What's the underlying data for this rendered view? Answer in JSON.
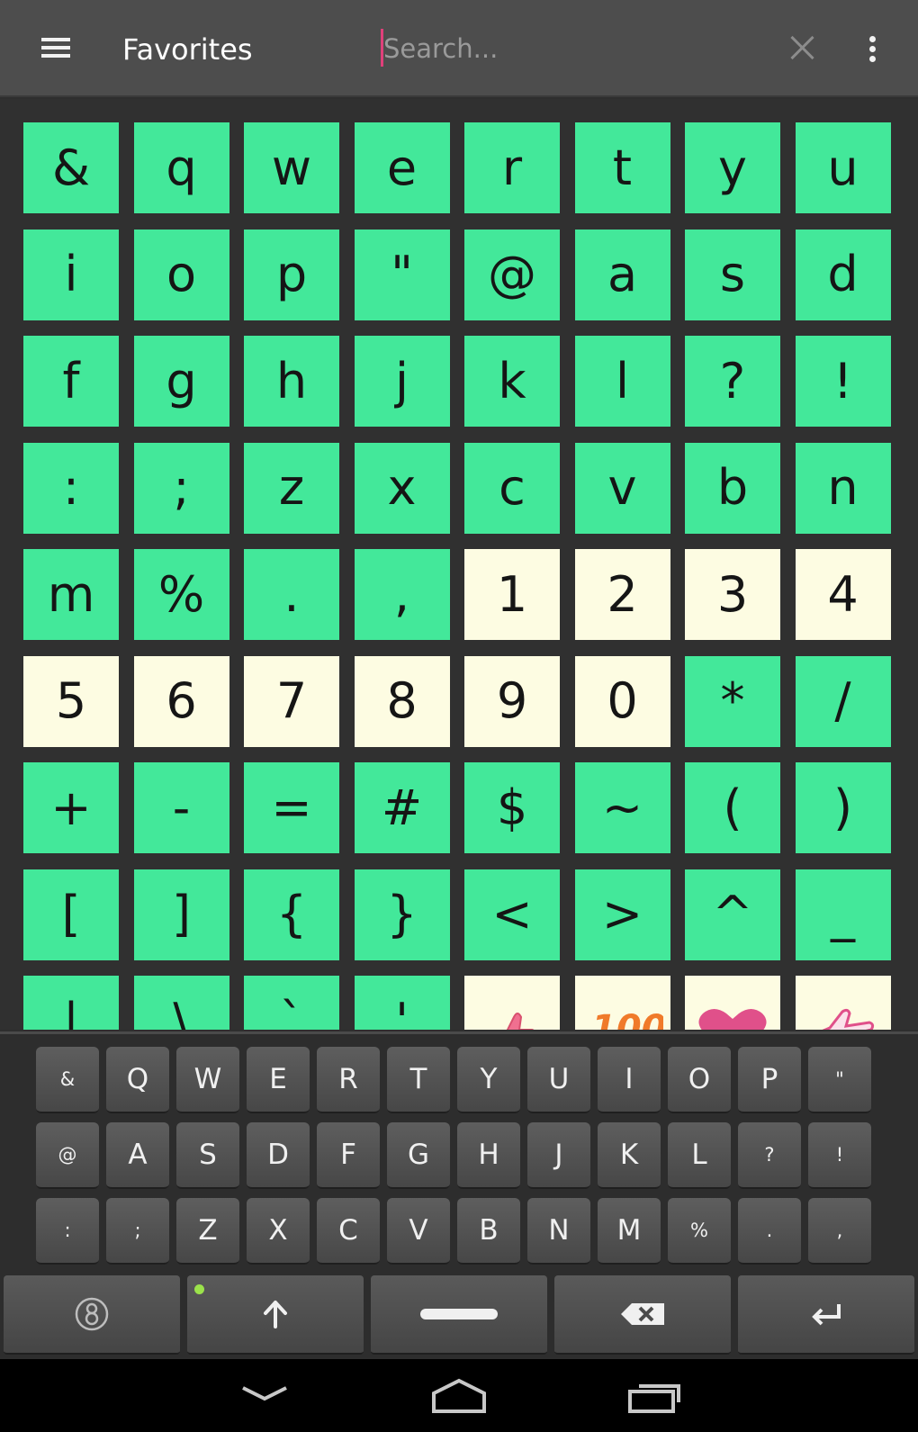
{
  "appbar": {
    "title": "Favorites",
    "search_placeholder": "Search...",
    "menu_icon": "hamburger-menu-icon",
    "clear_icon": "close-icon",
    "overflow_icon": "overflow-menu-icon"
  },
  "colors": {
    "appbar_bg": "#4d4d4d",
    "grid_bg": "#303030",
    "cell_symbol": "#43e89a",
    "cell_digit": "#fdfce2",
    "search_cursor": "#e0407a",
    "shift_indicator": "#9be24b"
  },
  "grid": {
    "rows": [
      [
        {
          "c": "&",
          "t": "green"
        },
        {
          "c": "q",
          "t": "green"
        },
        {
          "c": "w",
          "t": "green"
        },
        {
          "c": "e",
          "t": "green"
        },
        {
          "c": "r",
          "t": "green"
        },
        {
          "c": "t",
          "t": "green"
        },
        {
          "c": "y",
          "t": "green"
        },
        {
          "c": "u",
          "t": "green"
        }
      ],
      [
        {
          "c": "i",
          "t": "green"
        },
        {
          "c": "o",
          "t": "green"
        },
        {
          "c": "p",
          "t": "green"
        },
        {
          "c": "\"",
          "t": "green"
        },
        {
          "c": "@",
          "t": "green"
        },
        {
          "c": "a",
          "t": "green"
        },
        {
          "c": "s",
          "t": "green"
        },
        {
          "c": "d",
          "t": "green"
        }
      ],
      [
        {
          "c": "f",
          "t": "green"
        },
        {
          "c": "g",
          "t": "green"
        },
        {
          "c": "h",
          "t": "green"
        },
        {
          "c": "j",
          "t": "green"
        },
        {
          "c": "k",
          "t": "green"
        },
        {
          "c": "l",
          "t": "green"
        },
        {
          "c": "?",
          "t": "green"
        },
        {
          "c": "!",
          "t": "green"
        }
      ],
      [
        {
          "c": ":",
          "t": "green"
        },
        {
          "c": ";",
          "t": "green"
        },
        {
          "c": "z",
          "t": "green"
        },
        {
          "c": "x",
          "t": "green"
        },
        {
          "c": "c",
          "t": "green"
        },
        {
          "c": "v",
          "t": "green"
        },
        {
          "c": "b",
          "t": "green"
        },
        {
          "c": "n",
          "t": "green"
        }
      ],
      [
        {
          "c": "m",
          "t": "green"
        },
        {
          "c": "%",
          "t": "green"
        },
        {
          "c": ".",
          "t": "green"
        },
        {
          "c": ",",
          "t": "green"
        },
        {
          "c": "1",
          "t": "cream"
        },
        {
          "c": "2",
          "t": "cream"
        },
        {
          "c": "3",
          "t": "cream"
        },
        {
          "c": "4",
          "t": "cream"
        }
      ],
      [
        {
          "c": "5",
          "t": "cream"
        },
        {
          "c": "6",
          "t": "cream"
        },
        {
          "c": "7",
          "t": "cream"
        },
        {
          "c": "8",
          "t": "cream"
        },
        {
          "c": "9",
          "t": "cream"
        },
        {
          "c": "0",
          "t": "cream"
        },
        {
          "c": "*",
          "t": "green"
        },
        {
          "c": "/",
          "t": "green"
        }
      ],
      [
        {
          "c": "+",
          "t": "green"
        },
        {
          "c": "-",
          "t": "green"
        },
        {
          "c": "=",
          "t": "green"
        },
        {
          "c": "#",
          "t": "green"
        },
        {
          "c": "$",
          "t": "green"
        },
        {
          "c": "~",
          "t": "green"
        },
        {
          "c": "(",
          "t": "green"
        },
        {
          "c": ")",
          "t": "green"
        }
      ],
      [
        {
          "c": "[",
          "t": "green"
        },
        {
          "c": "]",
          "t": "green"
        },
        {
          "c": "{",
          "t": "green"
        },
        {
          "c": "}",
          "t": "green"
        },
        {
          "c": "<",
          "t": "green"
        },
        {
          "c": ">",
          "t": "green"
        },
        {
          "c": "^",
          "t": "green"
        },
        {
          "c": "_",
          "t": "green"
        }
      ],
      [
        {
          "c": "|",
          "t": "green"
        },
        {
          "c": "\\",
          "t": "green"
        },
        {
          "c": "`",
          "t": "green"
        },
        {
          "c": "'",
          "t": "green"
        },
        {
          "c": "",
          "t": "emoji",
          "icon": "thumbs-up-emoji-icon"
        },
        {
          "c": "",
          "t": "emoji",
          "icon": "hundred-points-emoji-icon"
        },
        {
          "c": "",
          "t": "emoji",
          "icon": "heart-emoji-icon"
        },
        {
          "c": "",
          "t": "emoji",
          "icon": "pointing-hand-emoji-icon"
        }
      ]
    ]
  },
  "keyboard": {
    "row1": [
      "&",
      "Q",
      "W",
      "E",
      "R",
      "T",
      "Y",
      "U",
      "I",
      "O",
      "P",
      "\""
    ],
    "row2": [
      "@",
      "A",
      "S",
      "D",
      "F",
      "G",
      "H",
      "J",
      "K",
      "L",
      "?",
      "!"
    ],
    "row3": [
      ":",
      ";",
      "Z",
      "X",
      "C",
      "V",
      "B",
      "N",
      "M",
      "%",
      ".",
      ","
    ],
    "bottom": {
      "symbols_icon": "symbols-logo-icon",
      "shift_icon": "shift-arrow-icon",
      "space_icon": "space-bar-icon",
      "backspace_icon": "backspace-icon",
      "enter_icon": "enter-icon"
    }
  },
  "navbar": {
    "back_icon": "back-chevron-icon",
    "home_icon": "home-icon",
    "recents_icon": "recent-apps-icon"
  }
}
